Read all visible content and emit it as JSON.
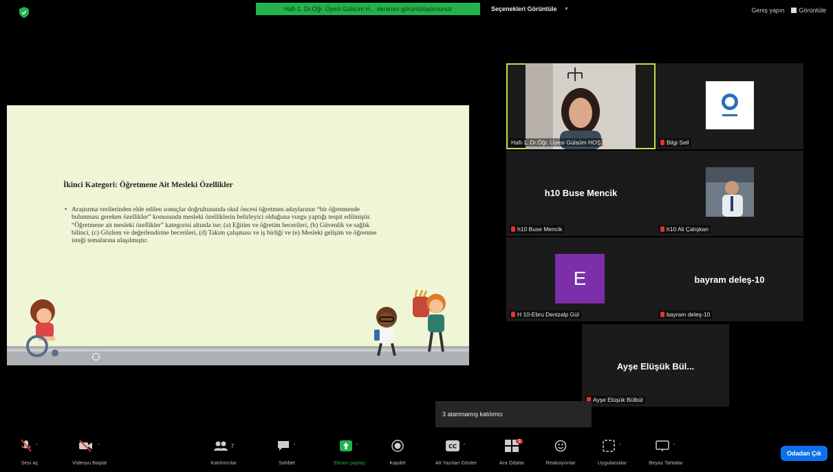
{
  "top": {
    "share_banner": "Hafi-1. Dr.Öğr. Üyesi Gülsüm H... ekranını görüntülüyorsunuz",
    "view_options": "Seçenekleri Görüntüle",
    "exit_fullscreen": "Geniş yapın",
    "view": "Görüntüle"
  },
  "slide": {
    "title": "İkinci Kategori: Öğretmene Ait Mesleki Özellikler",
    "body": "Araştırma verilerinden elde edilen sonuçlar doğrultusunda okul öncesi öğretmen adaylarının “bir öğretmende bulunması gereken özellikler” konusunda mesleki özelliklerin belirleyici olduğuna vurgu yaptığı tespit edilmiştir. “Öğretmene ait mesleki özellikler” kategorisi altında ise; (a) Eğitim ve öğretim becerileri, (b) Güvenlik ve sağlık bilinci, (c) Gözlem ve değerlendirme becerileri, (d) Takım çalışması ve iş birliği ve (e) Mesleki gelişim ve öğrenme isteği temalarına ulaşılmıştır."
  },
  "participants": [
    {
      "label": "Hafi-1. Dr.Öğr. Üyesi Gülsüm HOŞ",
      "big": ""
    },
    {
      "label": "Bilgi Sell",
      "big": ""
    },
    {
      "label": "h10 Buse Mencik",
      "big": "h10 Buse Mencik"
    },
    {
      "label": "h10 Ali Çalışkan",
      "big": ""
    },
    {
      "label": "H 10-Ebru Denizalp Gül",
      "big": "",
      "avatar": "E"
    },
    {
      "label": "bayram deleş-10",
      "big": "bayram deleş-10"
    },
    {
      "label": "Ayşe Elüşük Bülbül",
      "big": "Ayşe Elüşük Bül..."
    }
  ],
  "tooltip": "3 atanmamış katılımcı",
  "toolbar": {
    "mute": "Sesi aç",
    "video": "Videoyu Başlat",
    "participants": "Katılımcılar",
    "participants_count": "7",
    "chat": "Sohbet",
    "share": "Ekranı paylaş",
    "record": "Kaydet",
    "captions": "Alt Yazıları Göster",
    "breakout": "Ara Odalar",
    "breakout_badge": "3",
    "reactions": "Reaksiyonlar",
    "apps": "Uygulamalar",
    "whiteboard": "Beyaz Tahtalar",
    "leave": "Odadan Çık"
  },
  "colors": {
    "share_green": "#23b24b",
    "active_speaker": "#c6e04a",
    "leave_blue": "#0e71eb",
    "avatar_purple": "#7b2fa8",
    "slide_bg": "#eef6d6"
  }
}
